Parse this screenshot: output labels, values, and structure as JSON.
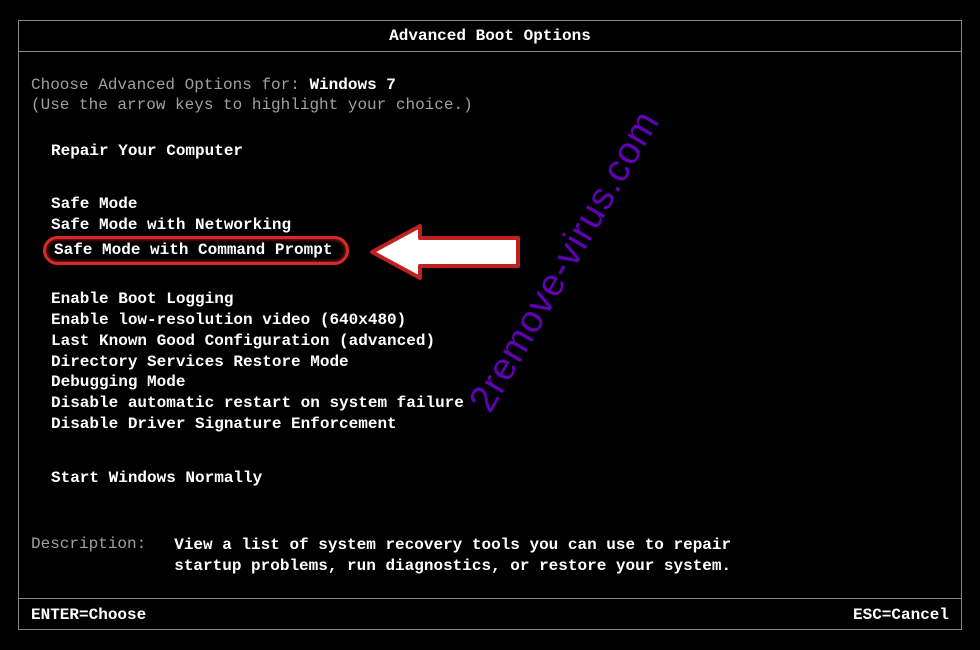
{
  "title": "Advanced Boot Options",
  "choose_prefix": "Choose Advanced Options for: ",
  "os_name": "Windows 7",
  "hint": "(Use the arrow keys to highlight your choice.)",
  "menu": {
    "repair": "Repair Your Computer",
    "group1": [
      "Safe Mode",
      "Safe Mode with Networking",
      "Safe Mode with Command Prompt"
    ],
    "group2": [
      "Enable Boot Logging",
      "Enable low-resolution video (640x480)",
      "Last Known Good Configuration (advanced)",
      "Directory Services Restore Mode",
      "Debugging Mode",
      "Disable automatic restart on system failure",
      "Disable Driver Signature Enforcement"
    ],
    "start_normal": "Start Windows Normally"
  },
  "description": {
    "label": "Description:",
    "text_line1": "View a list of system recovery tools you can use to repair",
    "text_line2": "startup problems, run diagnostics, or restore your system."
  },
  "footer": {
    "enter": "ENTER=Choose",
    "esc": "ESC=Cancel"
  },
  "watermark": "2remove-virus.com"
}
